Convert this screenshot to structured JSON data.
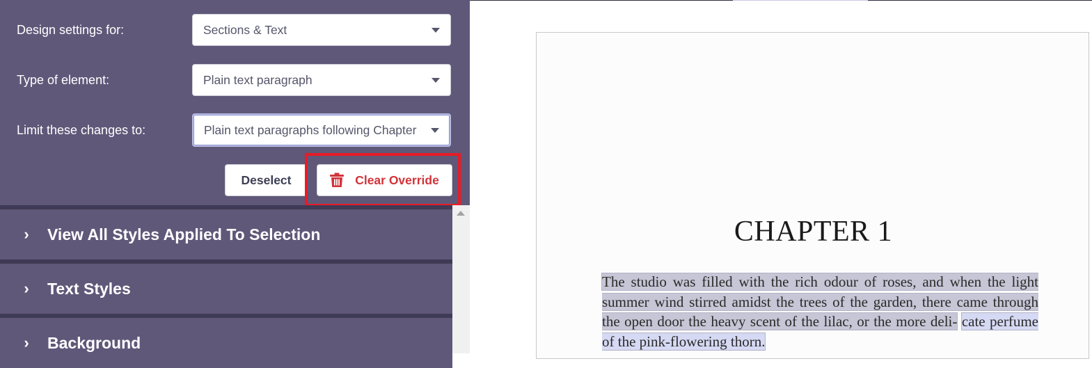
{
  "settings": {
    "design_label": "Design settings for:",
    "design_value": "Sections & Text",
    "type_label": "Type of element:",
    "type_value": "Plain text paragraph",
    "limit_label": "Limit these changes to:",
    "limit_value": "Plain text paragraphs following Chapter"
  },
  "buttons": {
    "deselect": "Deselect",
    "clear_override": "Clear Override"
  },
  "sections": [
    {
      "label": "View All Styles Applied To Selection"
    },
    {
      "label": "Text Styles"
    },
    {
      "label": "Background"
    }
  ],
  "preview": {
    "chapter_title": "CHAPTER 1",
    "paragraph": "The studio was filled with the rich odour of roses, and when the light summer wind stirred amidst the trees of the garden, there came through the open door the heavy scent of the lilac, or the more deli-",
    "paragraph_last_line": "cate perfume of the pink-flowering thorn."
  },
  "colors": {
    "panel": "#5f5879",
    "divider": "#3f3a55",
    "danger": "#d2333a",
    "highlight": "#e81c26",
    "selection": "#c6c6d6"
  },
  "icons": {
    "caret": "chevron-down-icon",
    "trash": "trash-icon",
    "expand": "chevron-right-icon"
  }
}
